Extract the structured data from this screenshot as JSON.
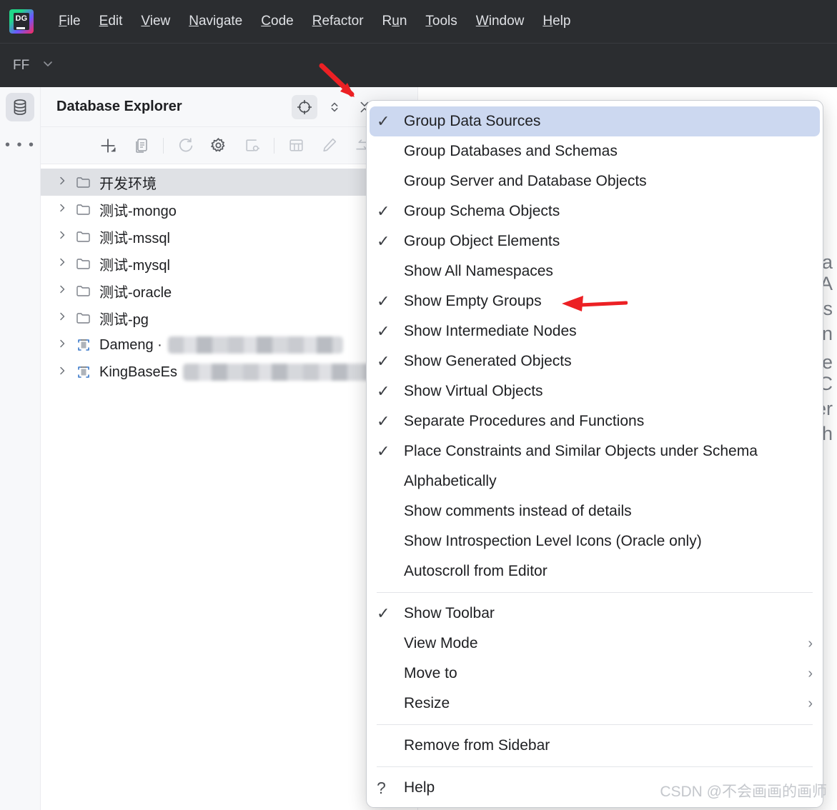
{
  "app": {
    "logo_text": "DG",
    "project_name": "FF"
  },
  "menubar": {
    "items": [
      {
        "label": "File",
        "mnemonic": "F",
        "rest": "ile"
      },
      {
        "label": "Edit",
        "mnemonic": "E",
        "rest": "dit"
      },
      {
        "label": "View",
        "mnemonic": "V",
        "rest": "iew"
      },
      {
        "label": "Navigate",
        "mnemonic": "N",
        "rest": "avigate"
      },
      {
        "label": "Code",
        "mnemonic": "C",
        "rest": "ode"
      },
      {
        "label": "Refactor",
        "mnemonic": "R",
        "rest": "efactor"
      },
      {
        "label": "Run",
        "mnemonic": "u",
        "pre": "R",
        "rest": "n"
      },
      {
        "label": "Tools",
        "mnemonic": "T",
        "rest": "ools"
      },
      {
        "label": "Window",
        "mnemonic": "W",
        "rest": "indow"
      },
      {
        "label": "Help",
        "mnemonic": "H",
        "rest": "elp"
      }
    ]
  },
  "rail": {
    "database_icon": "database-icon",
    "more_label": "• • •"
  },
  "panel": {
    "title": "Database Explorer",
    "header_buttons": [
      {
        "name": "locate-icon",
        "glyph": "target"
      },
      {
        "name": "expand-collapse-icon",
        "glyph": "chevrons"
      },
      {
        "name": "collapse-all-icon",
        "glyph": "collapse"
      },
      {
        "name": "options-kebab-icon",
        "glyph": "kebab"
      }
    ],
    "toolbar_buttons": [
      {
        "name": "add-new-icon"
      },
      {
        "name": "duplicate-icon"
      },
      {
        "name": "refresh-icon"
      },
      {
        "name": "data-source-properties-icon"
      },
      {
        "name": "disconnect-icon"
      },
      {
        "name": "open-table-editor-icon"
      },
      {
        "name": "modify-object-icon"
      },
      {
        "name": "jump-to-console-icon"
      },
      {
        "name": "open-console-icon"
      }
    ]
  },
  "tree": {
    "items": [
      {
        "label": "开发环境",
        "icon": "folder-icon",
        "selected": true,
        "redacted": 0
      },
      {
        "label": "测试-mongo",
        "icon": "folder-icon",
        "selected": false,
        "redacted": 0
      },
      {
        "label": "测试-mssql",
        "icon": "folder-icon",
        "selected": false,
        "redacted": 0
      },
      {
        "label": "测试-mysql",
        "icon": "folder-icon",
        "selected": false,
        "redacted": 0
      },
      {
        "label": "测试-oracle",
        "icon": "folder-icon",
        "selected": false,
        "redacted": 0
      },
      {
        "label": "测试-pg",
        "icon": "folder-icon",
        "selected": false,
        "redacted": 0
      },
      {
        "label": "Dameng ·",
        "icon": "data-source-icon",
        "selected": false,
        "redacted": 245
      },
      {
        "label": "KingBaseEs",
        "icon": "data-source-icon",
        "selected": false,
        "redacted": 300
      }
    ]
  },
  "editor": {
    "visible_fragments": [
      "a",
      "A",
      "es",
      "n",
      "e",
      "C",
      "er",
      "h"
    ]
  },
  "popup": {
    "groups": [
      {
        "items": [
          {
            "label": "Group Data Sources",
            "checked": true,
            "selected": true
          },
          {
            "label": "Group Databases and Schemas",
            "checked": false,
            "selected": false
          },
          {
            "label": "Group Server and Database Objects",
            "checked": false,
            "selected": false
          },
          {
            "label": "Group Schema Objects",
            "checked": true,
            "selected": false
          },
          {
            "label": "Group Object Elements",
            "checked": true,
            "selected": false
          },
          {
            "label": "Show All Namespaces",
            "checked": false,
            "selected": false
          },
          {
            "label": "Show Empty Groups",
            "checked": true,
            "selected": false
          },
          {
            "label": "Show Intermediate Nodes",
            "checked": true,
            "selected": false
          },
          {
            "label": "Show Generated Objects",
            "checked": true,
            "selected": false
          },
          {
            "label": "Show Virtual Objects",
            "checked": true,
            "selected": false
          },
          {
            "label": "Separate Procedures and Functions",
            "checked": true,
            "selected": false
          },
          {
            "label": "Place Constraints and Similar Objects under Schema",
            "checked": true,
            "selected": false
          },
          {
            "label": "Alphabetically",
            "checked": false,
            "selected": false
          },
          {
            "label": "Show comments instead of details",
            "checked": false,
            "selected": false
          },
          {
            "label": "Show Introspection Level Icons (Oracle only)",
            "checked": false,
            "selected": false
          },
          {
            "label": "Autoscroll from Editor",
            "checked": false,
            "selected": false
          }
        ]
      },
      {
        "items": [
          {
            "label": "Show Toolbar",
            "checked": true,
            "selected": false
          },
          {
            "label": "View Mode",
            "checked": false,
            "selected": false,
            "submenu": true
          },
          {
            "label": "Move to",
            "checked": false,
            "selected": false,
            "submenu": true
          },
          {
            "label": "Resize",
            "checked": false,
            "selected": false,
            "submenu": true
          }
        ]
      },
      {
        "items": [
          {
            "label": "Remove from Sidebar",
            "checked": false,
            "selected": false
          }
        ]
      },
      {
        "items": [
          {
            "label": "Help",
            "checked": false,
            "selected": false,
            "help": true
          }
        ]
      }
    ],
    "check_glyph": "✓",
    "submenu_glyph": "›",
    "help_glyph": "?"
  },
  "annotations": {
    "arrow_color": "#ec2024",
    "arrow_targets": [
      "options-kebab-icon",
      "Show Empty Groups"
    ]
  },
  "watermark": {
    "text": "CSDN @不会画画的画师"
  }
}
